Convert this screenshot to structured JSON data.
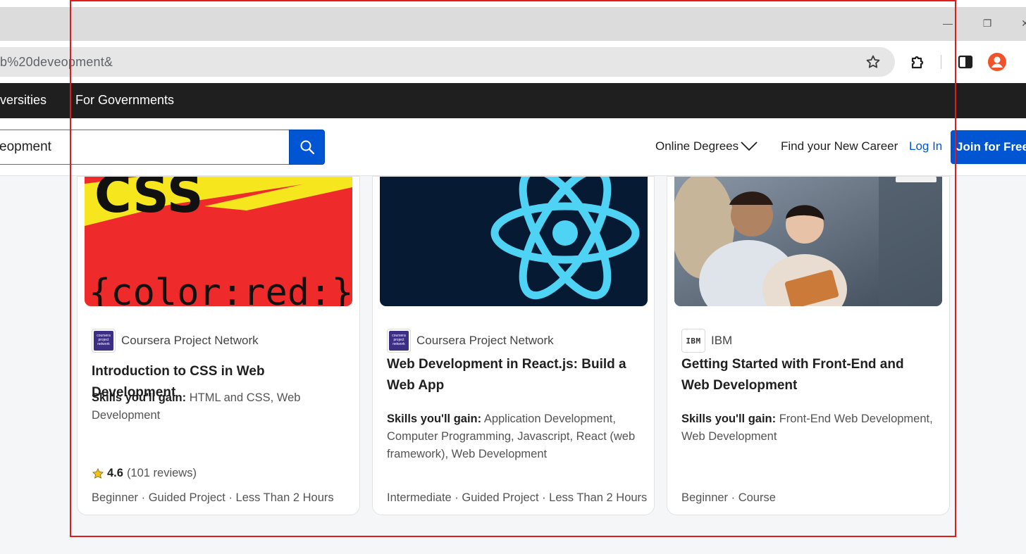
{
  "browser": {
    "url_fragment": "b%20deveopment&",
    "minimize_glyph": "—",
    "restore_glyph": "❐",
    "close_glyph": "✕",
    "icons": [
      "star-icon",
      "extensions-icon",
      "side-panel-icon",
      "profile-avatar-icon"
    ]
  },
  "topnav": {
    "items": [
      "versities",
      "For Governments"
    ]
  },
  "header": {
    "search_value": "eopment",
    "online_degrees": "Online Degrees",
    "find_career": "Find your New Career",
    "login": "Log In",
    "join": "Join for Free"
  },
  "cards": [
    {
      "image_text": "{color:red:}",
      "image_top_text": "CSS",
      "partner": "Coursera Project Network",
      "partner_logo_text": [
        "coursera",
        "project",
        "network"
      ],
      "title": "Introduction to CSS in Web Development",
      "skills_label": "Skills you'll gain:",
      "skills": "HTML and CSS, Web Development",
      "rating": "4.6",
      "reviews": "(101 reviews)",
      "meta": "Beginner · Guided Project · Less Than 2 Hours"
    },
    {
      "partner": "Coursera Project Network",
      "partner_logo_text": [
        "coursera",
        "project",
        "network"
      ],
      "title": "Web Development in React.js: Build a Web App",
      "skills_label": "Skills you'll gain:",
      "skills": "Application Development, Computer Programming, Javascript, React (web framework), Web Development",
      "meta": "Intermediate · Guided Project · Less Than 2 Hours"
    },
    {
      "partner": "IBM",
      "partner_logo_text": "IBM",
      "title": "Getting Started with Front-End and Web Development",
      "skills_label": "Skills you'll gain:",
      "skills": "Front-End Web Development, Web Development",
      "meta": "Beginner · Course"
    }
  ],
  "colors": {
    "brand_blue": "#0056d2",
    "topnav_bg": "#1f1f1f",
    "highlight_frame": "#e01b1b",
    "react_cyan": "#4fd3f5",
    "css_red": "#ee2a2a",
    "css_yellow": "#f5e61e"
  }
}
